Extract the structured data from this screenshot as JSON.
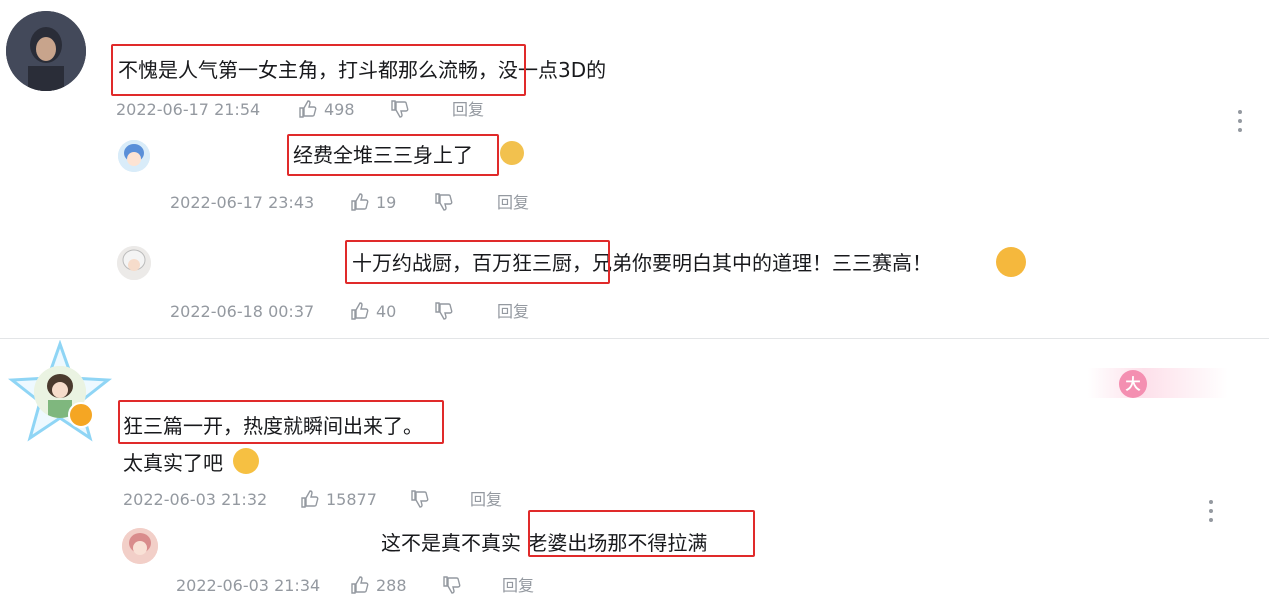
{
  "comments": [
    {
      "text": "不愧是人气第一女主角，打斗都那么流畅，没一点3D的",
      "time": "2022-06-17 21:54",
      "likes": "498",
      "reply_label": "回复",
      "replies": [
        {
          "text": "经费全堆三三身上了",
          "time": "2022-06-17 23:43",
          "likes": "19",
          "reply_label": "回复"
        },
        {
          "text": "十万约战厨，百万狂三厨，兄弟你要明白其中的道理！三三赛高！",
          "time": "2022-06-18 00:37",
          "likes": "40",
          "reply_label": "回复"
        }
      ]
    },
    {
      "text_line1": "狂三篇一开，热度就瞬间出来了。",
      "text_line2": "太真实了吧",
      "time": "2022-06-03 21:32",
      "likes": "15877",
      "reply_label": "回复",
      "badge": "大",
      "replies": [
        {
          "text": "这不是真不真实 老婆出场那不得拉满",
          "time": "2022-06-03 21:34",
          "likes": "288",
          "reply_label": "回复"
        }
      ]
    }
  ],
  "colors": {
    "highlight": "#e02a2a",
    "meta": "#9499a0",
    "text": "#18191c",
    "accent": "#fb7299"
  }
}
